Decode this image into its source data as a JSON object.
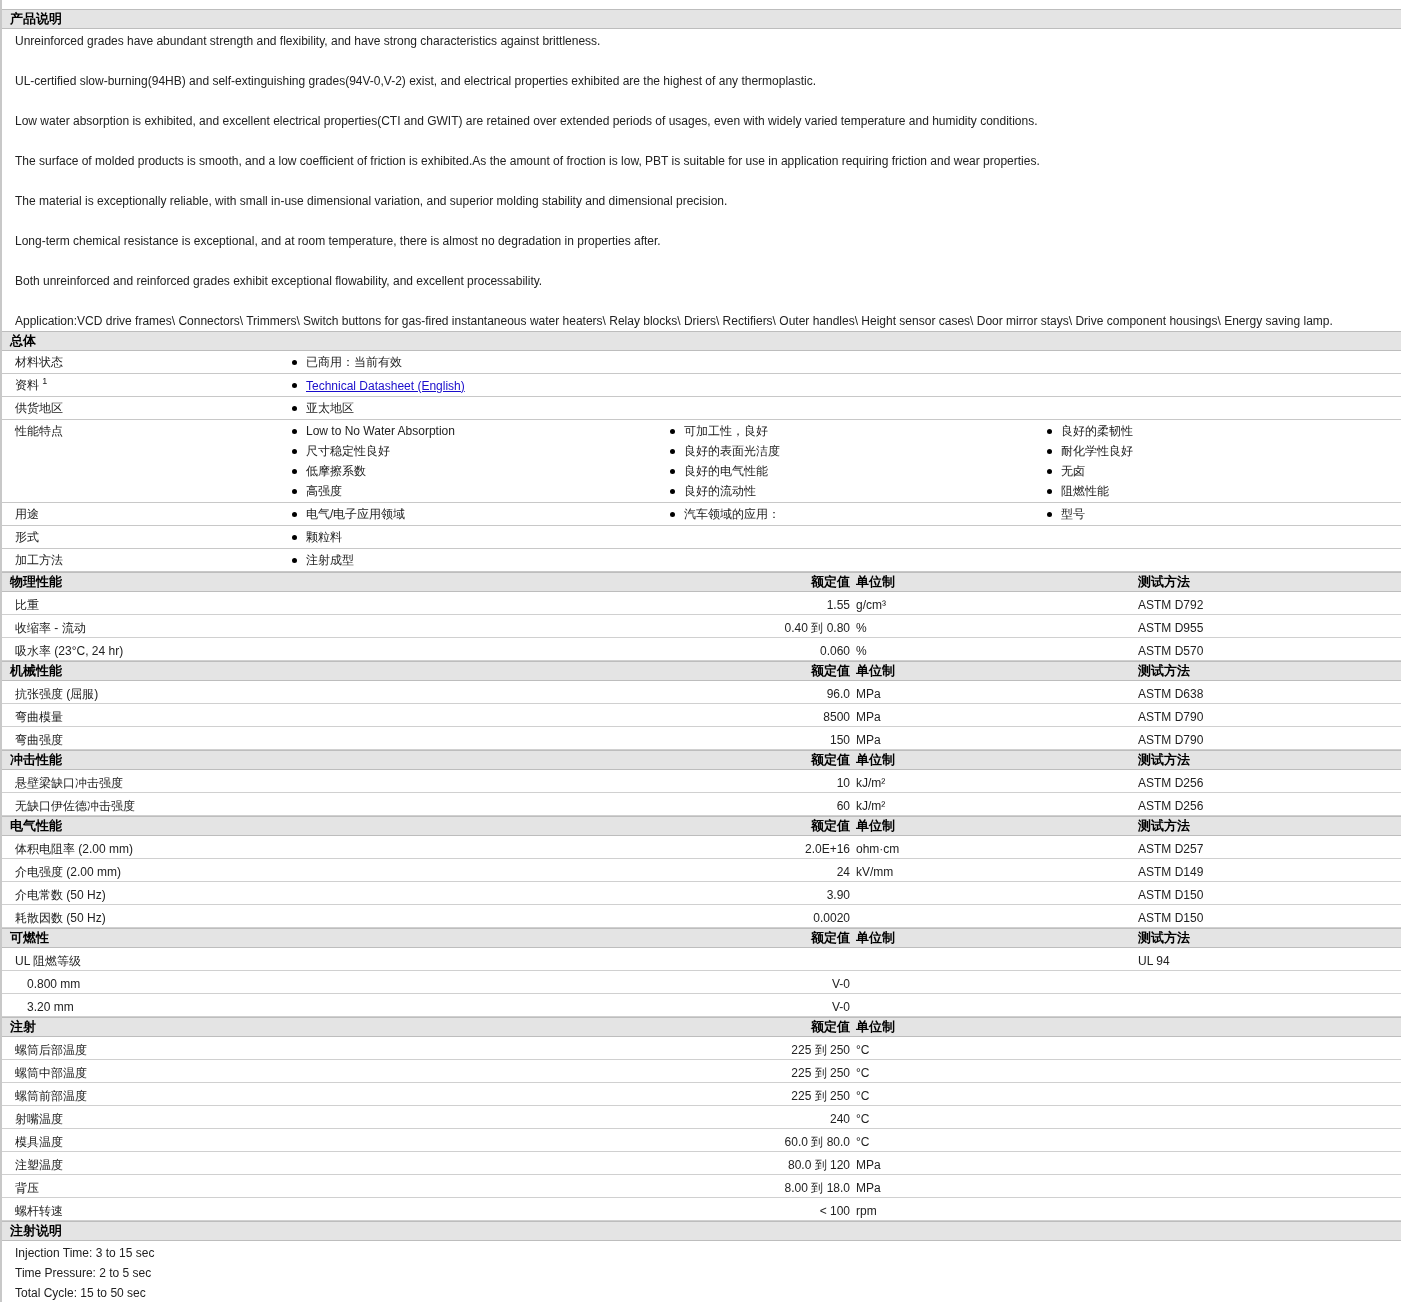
{
  "sections": [
    {
      "kind": "paragraphs",
      "title": "产品说明",
      "lines": [
        "Unreinforced grades have abundant strength and flexibility, and have strong characteristics against brittleness.",
        "UL-certified slow-burning(94HB) and self-extinguishing grades(94V-0,V-2) exist, and electrical properties exhibited are the highest of any thermoplastic.",
        "Low water absorption is exhibited, and excellent electrical properties(CTI and GWIT) are retained over extended periods of usages, even with widely varied temperature and humidity conditions.",
        "The surface of molded products is smooth, and a low coefficient of friction is exhibited.As the amount of froction is low, PBT is suitable for use in application requiring friction and wear properties.",
        "The material is exceptionally reliable, with small in-use dimensional variation, and superior molding stability and dimensional precision.",
        "Long-term chemical resistance is exceptional, and at room temperature, there is almost no degradation in properties after.",
        "Both unreinforced and reinforced grades exhibit exceptional flowability, and excellent processability.",
        "Application:VCD drive frames\\ Connectors\\ Trimmers\\ Switch buttons for gas-fired instantaneous water heaters\\ Relay blocks\\ Driers\\ Rectifiers\\ Outer handles\\ Height sensor cases\\ Door mirror stays\\ Drive component housings\\ Energy saving lamp."
      ]
    },
    {
      "kind": "general",
      "title": "总体",
      "rows": [
        {
          "label": "材料状态",
          "columns": [
            [
              {
                "kind": "text",
                "text": "已商用：当前有效"
              }
            ]
          ]
        },
        {
          "label": "资料 $^{1}$",
          "columns": [
            [
              {
                "kind": "link",
                "text": "Technical Datasheet (English)"
              }
            ]
          ]
        },
        {
          "label": "供货地区",
          "columns": [
            [
              {
                "kind": "text",
                "text": "亚太地区"
              }
            ]
          ]
        },
        {
          "label": "性能特点",
          "columns": [
            [
              {
                "kind": "text",
                "text": "Low to No Water Absorption"
              },
              {
                "kind": "text",
                "text": "尺寸稳定性良好"
              },
              {
                "kind": "text",
                "text": "低摩擦系数"
              },
              {
                "kind": "text",
                "text": "高强度"
              }
            ],
            [
              {
                "kind": "text",
                "text": "可加工性，良好"
              },
              {
                "kind": "text",
                "text": "良好的表面光洁度"
              },
              {
                "kind": "text",
                "text": "良好的电气性能"
              },
              {
                "kind": "text",
                "text": "良好的流动性"
              }
            ],
            [
              {
                "kind": "text",
                "text": "良好的柔韧性"
              },
              {
                "kind": "text",
                "text": "耐化学性良好"
              },
              {
                "kind": "text",
                "text": "无卤"
              },
              {
                "kind": "text",
                "text": "阻燃性能"
              }
            ]
          ]
        },
        {
          "label": "用途",
          "columns": [
            [
              {
                "kind": "text",
                "text": "电气/电子应用领域"
              }
            ],
            [
              {
                "kind": "text",
                "text": "汽车领域的应用："
              }
            ],
            [
              {
                "kind": "text",
                "text": "型号"
              }
            ]
          ]
        },
        {
          "label": "形式",
          "columns": [
            [
              {
                "kind": "text",
                "text": "颗粒料"
              }
            ]
          ]
        },
        {
          "label": "加工方法",
          "columns": [
            [
              {
                "kind": "text",
                "text": "注射成型"
              }
            ]
          ]
        }
      ]
    },
    {
      "kind": "properties",
      "title": "物理性能",
      "value_heading": "额定值",
      "unit_heading": "单位制",
      "method_heading": "测试方法",
      "rows": [
        {
          "name": "比重",
          "value": "1.55",
          "unit": "g/cm³",
          "method": "ASTM D792"
        },
        {
          "name": "收缩率  - 流动",
          "value": "0.40 到  0.80",
          "unit": "%",
          "method": "ASTM D955"
        },
        {
          "name": "吸水率  (23°C, 24 hr)",
          "value": "0.060",
          "unit": "%",
          "method": "ASTM D570"
        }
      ]
    },
    {
      "kind": "properties",
      "title": "机械性能",
      "value_heading": "额定值",
      "unit_heading": "单位制",
      "method_heading": "测试方法",
      "rows": [
        {
          "name": "抗张强度  (屈服)",
          "value": "96.0",
          "unit": "MPa",
          "method": "ASTM D638"
        },
        {
          "name": "弯曲模量",
          "value": "8500",
          "unit": "MPa",
          "method": "ASTM D790"
        },
        {
          "name": "弯曲强度",
          "value": "150",
          "unit": "MPa",
          "method": "ASTM D790"
        }
      ]
    },
    {
      "kind": "properties",
      "title": "冲击性能",
      "value_heading": "额定值",
      "unit_heading": "单位制",
      "method_heading": "测试方法",
      "rows": [
        {
          "name": "悬壁梁缺口冲击强度",
          "value": "10",
          "unit": "kJ/m²",
          "method": "ASTM D256"
        },
        {
          "name": "无缺口伊佐德冲击强度",
          "value": "60",
          "unit": "kJ/m²",
          "method": "ASTM D256"
        }
      ]
    },
    {
      "kind": "properties",
      "title": "电气性能",
      "value_heading": "额定值",
      "unit_heading": "单位制",
      "method_heading": "测试方法",
      "rows": [
        {
          "name": "体积电阻率  (2.00 mm)",
          "value": "2.0E+16",
          "unit": "ohm·cm",
          "method": "ASTM D257"
        },
        {
          "name": "介电强度  (2.00 mm)",
          "value": "24",
          "unit": "kV/mm",
          "method": "ASTM D149"
        },
        {
          "name": "介电常数  (50 Hz)",
          "value": "3.90",
          "method": "ASTM D150"
        },
        {
          "name": "耗散因数  (50 Hz)",
          "value": "0.0020",
          "method": "ASTM D150"
        }
      ]
    },
    {
      "kind": "properties",
      "title": "可燃性",
      "value_heading": "额定值",
      "unit_heading": "单位制",
      "method_heading": "测试方法",
      "rows": [
        {
          "name": "UL 阻燃等级",
          "method": "UL 94",
          "children": [
            {
              "name": "0.800 mm",
              "value": "V-0"
            },
            {
              "name": "3.20 mm",
              "value": "V-0"
            }
          ]
        }
      ]
    },
    {
      "kind": "properties",
      "title": "注射",
      "value_heading": "额定值",
      "unit_heading": "单位制",
      "rows": [
        {
          "name": "螺筒后部温度",
          "value": "225 到  250",
          "unit": "°C"
        },
        {
          "name": "螺筒中部温度",
          "value": "225 到  250",
          "unit": "°C"
        },
        {
          "name": "螺筒前部温度",
          "value": "225 到  250",
          "unit": "°C"
        },
        {
          "name": "射嘴温度",
          "value": "240",
          "unit": "°C"
        },
        {
          "name": "模具温度",
          "value": "60.0 到  80.0",
          "unit": "°C"
        },
        {
          "name": "注塑温度",
          "value": "80.0 到  120",
          "unit": "MPa"
        },
        {
          "name": "背压",
          "value": "8.00 到  18.0",
          "unit": "MPa"
        },
        {
          "name": "螺杆转速",
          "value": "< 100",
          "unit": "rpm"
        }
      ]
    },
    {
      "kind": "lines",
      "title": "注射说明",
      "lines": [
        "Injection Time: 3 to 15 sec",
        "Time Pressure: 2 to 5 sec",
        "Total Cycle: 15 to 50 sec"
      ]
    }
  ]
}
